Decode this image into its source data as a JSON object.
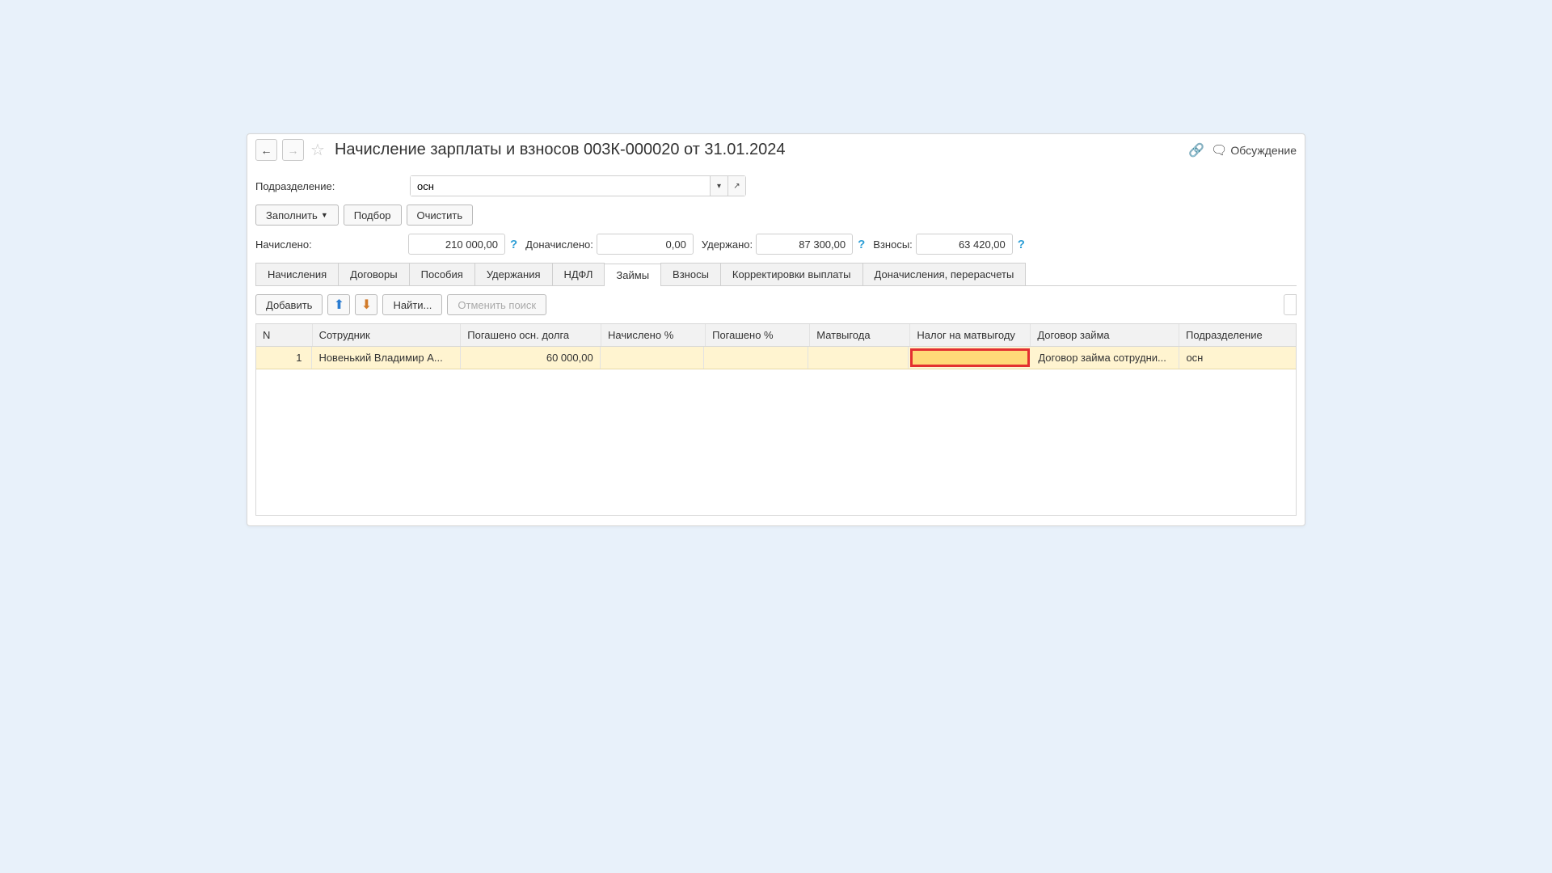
{
  "header": {
    "title": "Начисление зарплаты и взносов 003К-000020 от 31.01.2024",
    "discuss": "Обсуждение"
  },
  "dept": {
    "label": "Подразделение:",
    "value": "осн"
  },
  "buttons": {
    "fill": "Заполнить",
    "pick": "Подбор",
    "clear": "Очистить",
    "add": "Добавить",
    "find": "Найти...",
    "cancel_search": "Отменить поиск"
  },
  "totals": {
    "accrued_label": "Начислено:",
    "accrued": "210 000,00",
    "extra_label": "Доначислено:",
    "extra": "0,00",
    "withheld_label": "Удержано:",
    "withheld": "87 300,00",
    "contrib_label": "Взносы:",
    "contrib": "63 420,00"
  },
  "tabs": [
    "Начисления",
    "Договоры",
    "Пособия",
    "Удержания",
    "НДФЛ",
    "Займы",
    "Взносы",
    "Корректировки выплаты",
    "Доначисления, перерасчеты"
  ],
  "active_tab_index": 5,
  "table": {
    "headers": {
      "n": "N",
      "emp": "Сотрудник",
      "paid": "Погашено осн. долга",
      "pct": "Начислено %",
      "repaid_pct": "Погашено %",
      "mat": "Матвыгода",
      "tax": "Налог на матвыгоду",
      "ctr": "Договор займа",
      "dept": "Подразделение"
    },
    "rows": [
      {
        "n": "1",
        "emp": "Новенький Владимир А...",
        "paid": "60 000,00",
        "pct": "",
        "repaid_pct": "",
        "mat": "",
        "tax": "",
        "ctr": "Договор займа сотрудни...",
        "dept": "осн"
      }
    ]
  }
}
